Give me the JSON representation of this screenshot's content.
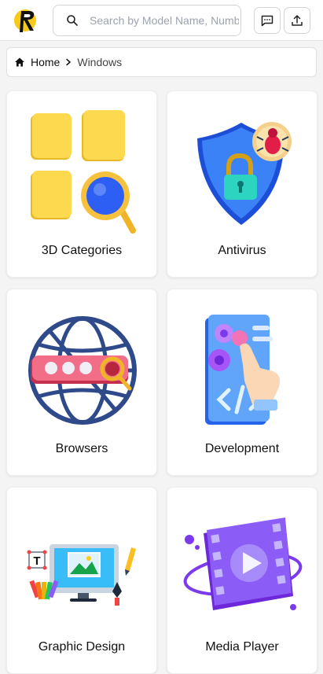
{
  "header": {
    "logo_icon": "r-logo-icon",
    "search": {
      "placeholder": "Search by Model Name, Number",
      "value": "",
      "icon": "search-icon"
    },
    "feedback_icon": "message-square-icon",
    "upload_icon": "upload-icon"
  },
  "breadcrumb": {
    "home_label": "Home",
    "current_label": "Windows"
  },
  "categories": [
    {
      "label": "3D Categories",
      "icon": "3d-tiles-magnifier-icon"
    },
    {
      "label": "Antivirus",
      "icon": "shield-lock-bug-icon"
    },
    {
      "label": "Browsers",
      "icon": "globe-password-icon"
    },
    {
      "label": "Development",
      "icon": "code-gear-hand-icon"
    },
    {
      "label": "Graphic Design",
      "icon": "monitor-design-tools-icon"
    },
    {
      "label": "Media Player",
      "icon": "film-play-icon"
    }
  ],
  "colors": {
    "accent_yellow": "#fcd34d",
    "accent_blue": "#2563eb",
    "accent_purple": "#7c3aed",
    "accent_pink": "#f0527a"
  }
}
